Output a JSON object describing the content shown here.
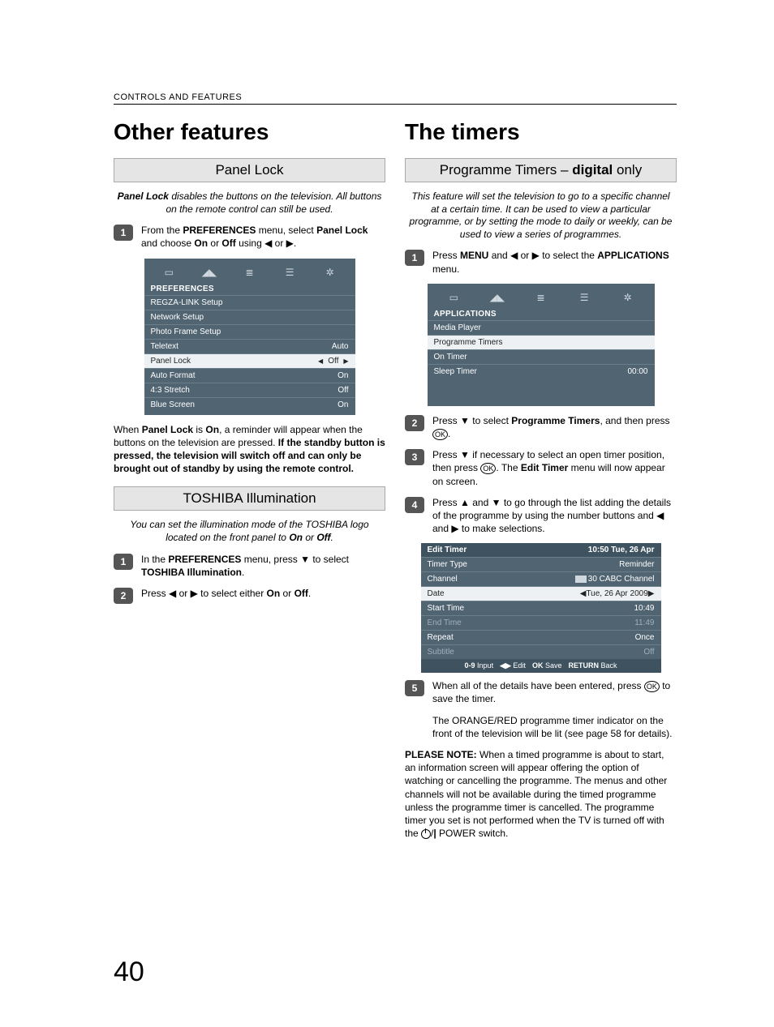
{
  "running_head": "CONTROLS AND FEATURES",
  "page_number": "40",
  "left": {
    "title": "Other features",
    "panel_lock": {
      "heading": "Panel Lock",
      "intro_html": "<b><i>Panel Lock</i></b> <i>disables the buttons on the television. All buttons on the remote control can still be used.</i>",
      "step1_html": "From the <b>PREFERENCES</b> menu, select <b>Panel Lock</b> and choose <b>On</b> or <b>Off</b> using <span class='glyph'>◀</span> or <span class='glyph'>▶</span>.",
      "after_html": "When <b>Panel Lock</b> is <b>On</b>, a reminder will appear when the buttons on the television are pressed. <b>If the standby button is pressed, the television will switch off and can only be brought out of standby by using the remote control.</b>",
      "osd": {
        "title": "PREFERENCES",
        "rows": [
          {
            "label": "REGZA-LINK Setup",
            "value": ""
          },
          {
            "label": "Network Setup",
            "value": ""
          },
          {
            "label": "Photo Frame Setup",
            "value": ""
          },
          {
            "label": "Teletext",
            "value": "Auto"
          },
          {
            "label": "Panel Lock",
            "value": "Off",
            "selected": true,
            "arrows": true
          },
          {
            "label": "Auto Format",
            "value": "On"
          },
          {
            "label": "4:3 Stretch",
            "value": "Off"
          },
          {
            "label": "Blue Screen",
            "value": "On"
          }
        ]
      }
    },
    "toshiba_illum": {
      "heading": "TOSHIBA Illumination",
      "intro_html": "<i>You can set the illumination mode of the TOSHIBA logo located on the front panel to <b>On</b> or <b>Off</b>.</i>",
      "step1_html": "In the <b>PREFERENCES</b> menu, press <span class='glyph'>▼</span> to select <b>TOSHIBA Illumination</b>.",
      "step2_html": "Press <span class='glyph'>◀</span> or <span class='glyph'>▶</span> to select either <b>On</b> or <b>Off</b>."
    }
  },
  "right": {
    "title": "The timers",
    "prog_timers": {
      "heading_html": "Programme Timers – <b>digital</b> only",
      "intro_html": "<i>This feature will set the television to go to a specific channel at a certain time. It can be used to view a particular programme, or by setting the mode to daily or weekly, can be used to view a series of programmes.</i>",
      "step1_html": "Press <b>MENU</b> and <span class='glyph'>◀</span> or <span class='glyph'>▶</span> to select the <b>APPLICATIONS</b> menu.",
      "osd1": {
        "title": "APPLICATIONS",
        "rows": [
          {
            "label": "Media Player",
            "value": ""
          },
          {
            "label": "Programme Timers",
            "value": "",
            "selected": true
          },
          {
            "label": "On Timer",
            "value": ""
          },
          {
            "label": "Sleep Timer",
            "value": "00:00"
          }
        ]
      },
      "step2_html": "Press <span class='glyph'>▼</span> to select <b>Programme Timers</b>, and then press <span class='ok'>OK</span>.",
      "step3_html": "Press <span class='glyph'>▼</span> if necessary to select an open timer position, then press <span class='ok'>OK</span>. The <b>Edit Timer</b> menu will now appear on screen.",
      "step4_html": "Press <span class='glyph'>▲</span> and <span class='glyph'>▼</span> to go through the list adding the details of the programme by using the number buttons and <span class='glyph'>◀</span> and <span class='glyph'>▶</span> to make selections.",
      "osd2": {
        "header_left": "Edit Timer",
        "header_right": "10:50 Tue, 26 Apr",
        "rows": [
          {
            "label": "Timer Type",
            "value": "Reminder"
          },
          {
            "label": "Channel",
            "value": "30 CABC Channel",
            "icon": true
          },
          {
            "label": "Date",
            "value": "Tue, 26 Apr 2009",
            "selected": true,
            "arrows": true
          },
          {
            "label": "Start Time",
            "value": "10:49"
          },
          {
            "label": "End Time",
            "value": "11:49",
            "dim": true
          },
          {
            "label": "Repeat",
            "value": "Once"
          },
          {
            "label": "Subtitle",
            "value": "Off",
            "dim": true
          }
        ],
        "footer": [
          {
            "key": "0-9",
            "label": "Input"
          },
          {
            "key": "◀▶",
            "label": "Edit"
          },
          {
            "key": "OK",
            "label": "Save"
          },
          {
            "key": "RETURN",
            "label": "Back"
          }
        ]
      },
      "step5a_html": "When all of the details have been entered, press <span class='ok'>OK</span> to save the timer.",
      "step5b_html": "The ORANGE/RED programme timer indicator on the front of the television will be lit (see page 58 for details).",
      "note_html": "<b>PLEASE NOTE:</b> When a timed programme is about to start, an information screen will appear offering the option of watching or cancelling the programme. The menus and other channels will not be available during the timed programme unless the programme timer is cancelled. The programme timer you set is not performed when the TV is turned off with the <span class='power'></span>/<b>|</b> POWER switch."
    }
  }
}
